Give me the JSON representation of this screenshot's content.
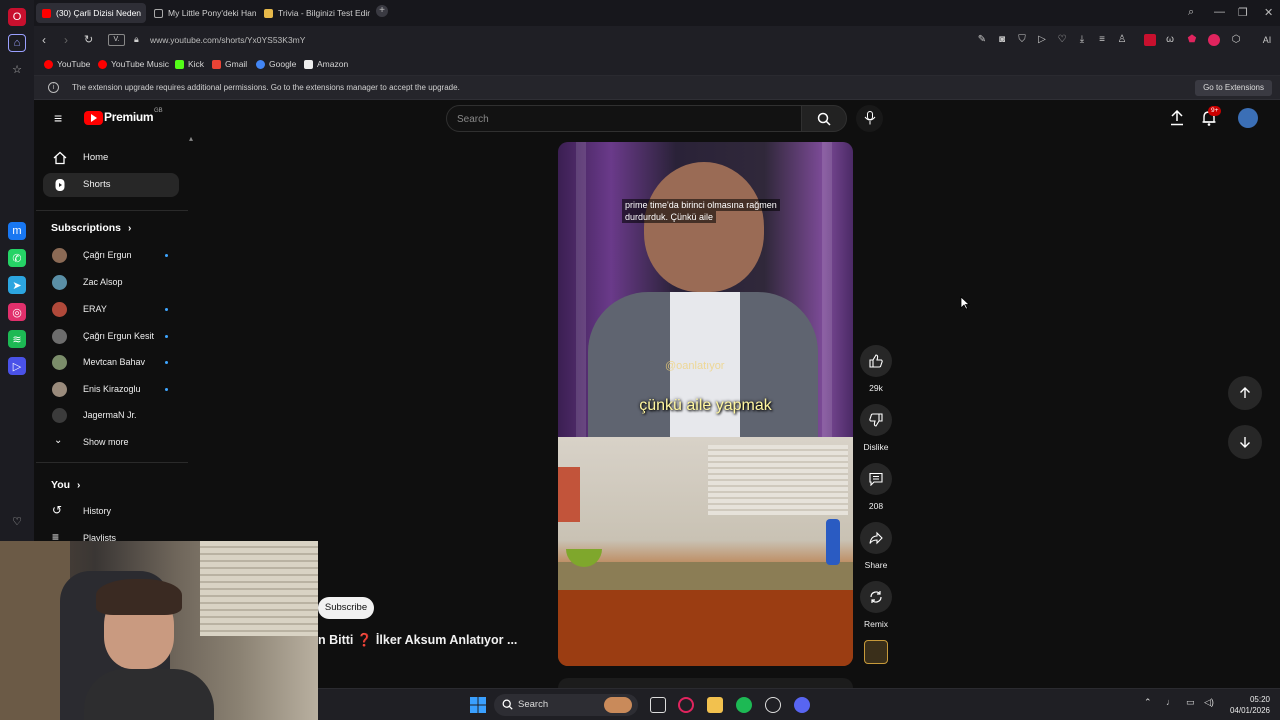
{
  "browser": {
    "tabs": [
      {
        "label": "(30) Çarli Dizisi Neden",
        "active": true
      },
      {
        "label": "My Little Pony'deki Hangi",
        "active": false
      },
      {
        "label": "Trivia - Bilginizi Test Edin",
        "active": false
      }
    ],
    "url": "www.youtube.com/shorts/Yx0YS53K3mY",
    "bookmarks": [
      "YouTube",
      "YouTube Music",
      "Kick",
      "Gmail",
      "Google",
      "Amazon"
    ],
    "notice": "The extension upgrade requires additional permissions. Go to the extensions manager to accept the upgrade.",
    "notice_button": "Go to Extensions",
    "ai_label": "AI"
  },
  "youtube": {
    "logo": "Premium",
    "logo_region": "GB",
    "search_placeholder": "Search",
    "notifications_badge": "9+",
    "nav": [
      {
        "label": "Home"
      },
      {
        "label": "Shorts"
      }
    ],
    "subscriptions_title": "Subscriptions",
    "subscriptions": [
      {
        "name": "Çağrı Ergun",
        "color": "#8b6a55",
        "new": true
      },
      {
        "name": "Zac Alsop",
        "color": "#5a8fa6",
        "new": false
      },
      {
        "name": "ERAY",
        "color": "#b0493a",
        "new": true
      },
      {
        "name": "Çağrı Ergun Kesit",
        "color": "#6d6d6d",
        "new": true
      },
      {
        "name": "Mevtcan Bahav",
        "color": "#7b8d6a",
        "new": true
      },
      {
        "name": "Enis Kirazoglu",
        "color": "#9a8b7c",
        "new": true
      },
      {
        "name": "JagermaN Jr.",
        "color": "#3b3b3b",
        "new": false
      }
    ],
    "show_more": "Show more",
    "you_title": "You",
    "you_items": [
      {
        "label": "History"
      },
      {
        "label": "Playlists"
      }
    ],
    "video": {
      "caption_top": [
        "prime time'da birinci olmasına rağmen",
        "durdurduk. Çünkü aile"
      ],
      "watermark": "@oanlatıyor",
      "caption_main": "çünkü aile yapmak"
    },
    "actions": [
      {
        "label": "29k",
        "icon": "like-icon"
      },
      {
        "label": "Dislike",
        "icon": "dislike-icon"
      },
      {
        "label": "208",
        "icon": "comment-icon"
      },
      {
        "label": "Share",
        "icon": "share-icon"
      },
      {
        "label": "Remix",
        "icon": "remix-icon"
      }
    ],
    "subscribe_label": "Subscribe",
    "title_fragment": "n Bitti ❓ İlker Aksum Anlatıyor ..."
  },
  "taskbar": {
    "search_placeholder": "Search",
    "time": "05:20",
    "date": "04/01/2026"
  }
}
